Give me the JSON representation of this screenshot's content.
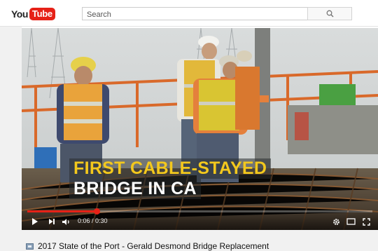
{
  "masthead": {
    "logo_you": "You",
    "logo_tube": "Tube",
    "search_placeholder": "Search",
    "search_icon": "magnifier-icon"
  },
  "player": {
    "caption_line1": "FIRST CABLE-STAYED",
    "caption_line2": "BRIDGE IN CA",
    "current_time": "0:06",
    "time_separator": " / ",
    "duration": "0:30",
    "progress_fraction": 0.2,
    "icons": {
      "play": "play-icon",
      "next": "next-icon",
      "volume": "volume-icon",
      "settings": "gear-icon",
      "theater": "theater-mode-icon",
      "fullscreen": "fullscreen-icon"
    },
    "accent_color": "#e62117",
    "caption_color": "#f3c81d"
  },
  "video": {
    "title": "2017 State of the Port - Gerald Desmond Bridge Replacement"
  }
}
